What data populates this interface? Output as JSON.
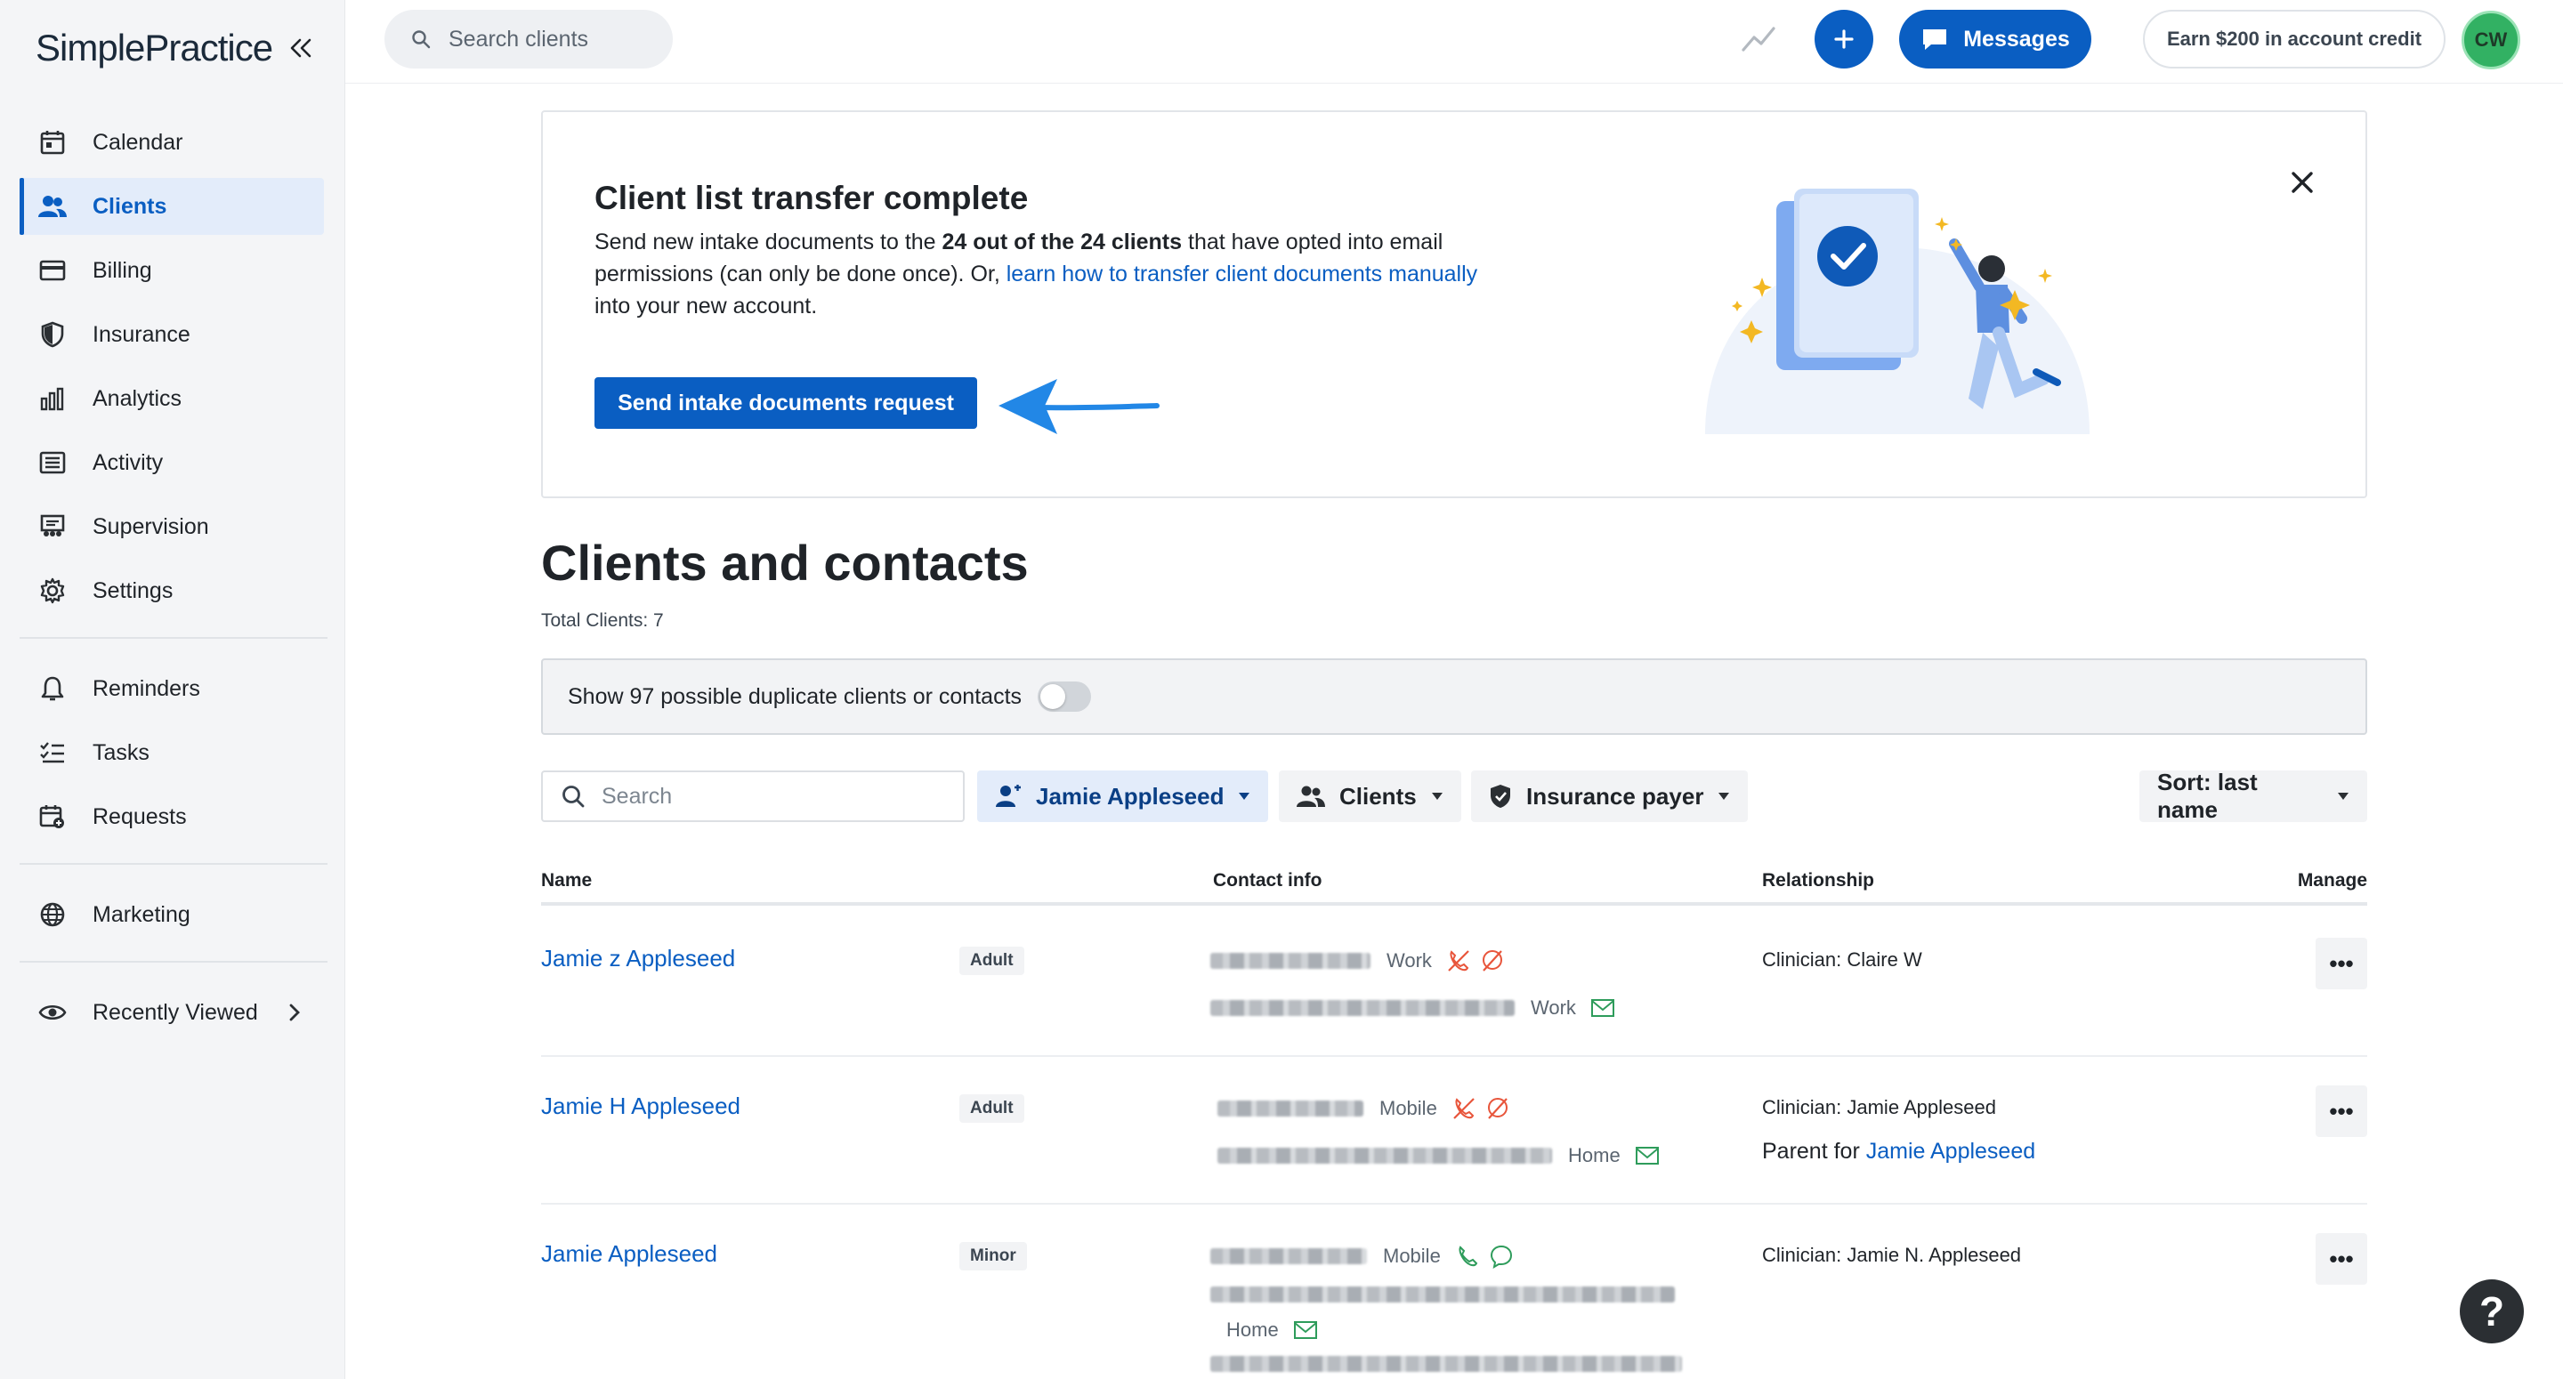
{
  "brand": {
    "name": "SimplePractice"
  },
  "sidebar": {
    "items": [
      {
        "label": "Calendar",
        "icon": "calendar-icon"
      },
      {
        "label": "Clients",
        "icon": "clients-icon",
        "active": true
      },
      {
        "label": "Billing",
        "icon": "billing-icon"
      },
      {
        "label": "Insurance",
        "icon": "shield-icon"
      },
      {
        "label": "Analytics",
        "icon": "analytics-icon"
      },
      {
        "label": "Activity",
        "icon": "activity-icon"
      },
      {
        "label": "Supervision",
        "icon": "supervision-icon"
      },
      {
        "label": "Settings",
        "icon": "gear-icon"
      }
    ],
    "secondary": [
      {
        "label": "Reminders",
        "icon": "bell-icon"
      },
      {
        "label": "Tasks",
        "icon": "tasks-icon"
      },
      {
        "label": "Requests",
        "icon": "requests-icon"
      }
    ],
    "marketing": {
      "label": "Marketing",
      "icon": "globe-icon"
    },
    "recently_viewed": {
      "label": "Recently Viewed",
      "icon": "eye-icon"
    }
  },
  "topbar": {
    "search_placeholder": "Search clients",
    "messages_label": "Messages",
    "credit_label": "Earn $200 in account credit",
    "avatar_initials": "CW"
  },
  "banner": {
    "title": "Client list transfer complete",
    "text_1": "Send new intake documents to the ",
    "text_bold": "24 out of the 24 clients",
    "text_2": " that have opted into email permissions (can only be done once). Or, ",
    "text_link": "learn how to transfer client documents manually",
    "text_3": " into your new account.",
    "button_label": "Send intake documents request"
  },
  "main": {
    "title": "Clients and contacts",
    "total_clients": "Total Clients: 7",
    "duplicates_label": "Show 97 possible duplicate clients or contacts",
    "duplicates_toggle_on": false,
    "search_placeholder": "Search",
    "filter_clinician": "Jamie Appleseed",
    "filter_type": "Clients",
    "filter_insurance": "Insurance payer",
    "sort_label": "Sort: last name"
  },
  "table": {
    "headers": {
      "name": "Name",
      "contact": "Contact info",
      "relationship": "Relationship",
      "manage": "Manage"
    },
    "rows": [
      {
        "name": "Jamie z Appleseed",
        "age": "Adult",
        "phone_label": "Work",
        "email_label": "Work",
        "relationship": "Clinician: Claire W"
      },
      {
        "name": "Jamie H Appleseed",
        "age": "Adult",
        "phone_label": "Mobile",
        "email_label": "Home",
        "relationship": "Clinician: Jamie Appleseed",
        "parent_prefix": "Parent for ",
        "parent_link": "Jamie Appleseed"
      },
      {
        "name": "Jamie Appleseed",
        "age": "Minor",
        "phone_label": "Mobile",
        "email_label": "Home",
        "relationship": "Clinician: Jamie N. Appleseed"
      }
    ],
    "manage_label": "•••"
  },
  "help_label": "?",
  "colors": {
    "accent": "#0a5ec2",
    "avatar": "#32b163",
    "alert": "#e8553b",
    "ok": "#2e9c5b"
  }
}
